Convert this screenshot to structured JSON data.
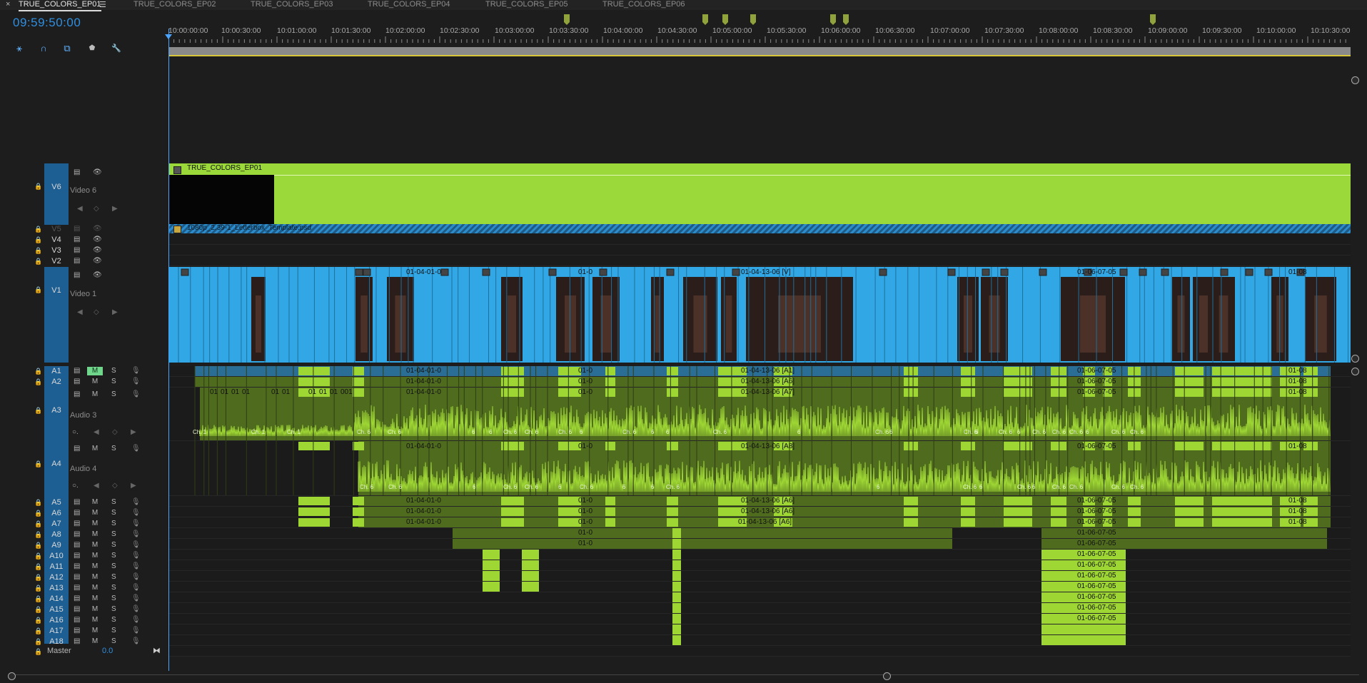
{
  "tabs": [
    {
      "label": "TRUE_COLORS_EP01",
      "active": true
    },
    {
      "label": "TRUE_COLORS_EP02",
      "active": false
    },
    {
      "label": "TRUE_COLORS_EP03",
      "active": false
    },
    {
      "label": "TRUE_COLORS_EP04",
      "active": false
    },
    {
      "label": "TRUE_COLORS_EP05",
      "active": false
    },
    {
      "label": "TRUE_COLORS_EP06",
      "active": false
    }
  ],
  "close_glyph": "×",
  "menu_glyph": "☰",
  "timecode": "09:59:50:00",
  "ruler_labels": [
    "10:00:00:00",
    "10:00:30:00",
    "10:01:00:00",
    "10:01:30:00",
    "10:02:00:00",
    "10:02:30:00",
    "10:03:00:00",
    "10:03:30:00",
    "10:04:00:00",
    "10:04:30:00",
    "10:05:00:00",
    "10:05:30:00",
    "10:06:00:00",
    "10:06:30:00",
    "10:07:00:00",
    "10:07:30:00",
    "10:08:00:00",
    "10:08:30:00",
    "10:09:00:00",
    "10:09:30:00",
    "10:10:00:00",
    "10:10:30:00"
  ],
  "tools": [
    {
      "icon": "snap-icon",
      "glyph": "⚹"
    },
    {
      "icon": "linked-selection-icon",
      "glyph": "∩"
    },
    {
      "icon": "add-marker-icon",
      "glyph": "⧉"
    },
    {
      "icon": "marker-icon",
      "glyph": "⬟"
    },
    {
      "icon": "wrench-icon",
      "glyph": "🔧"
    }
  ],
  "video_tracks": [
    {
      "id": "V6",
      "label": "Video 6"
    },
    {
      "id": "V5"
    },
    {
      "id": "V4"
    },
    {
      "id": "V3"
    },
    {
      "id": "V2"
    },
    {
      "id": "V1",
      "label": "Video 1"
    }
  ],
  "audio_tracks": [
    {
      "id": "A1",
      "m": "M",
      "mute_on": true,
      "s": "S"
    },
    {
      "id": "A2",
      "m": "M",
      "s": "S"
    },
    {
      "id": "A3",
      "label": "Audio 3",
      "m": "M",
      "s": "S"
    },
    {
      "id": "A4",
      "label": "Audio 4",
      "m": "M",
      "s": "S"
    },
    {
      "id": "A5",
      "m": "M",
      "s": "S"
    },
    {
      "id": "A6",
      "m": "M",
      "s": "S"
    },
    {
      "id": "A7",
      "m": "M",
      "s": "S"
    },
    {
      "id": "A8",
      "m": "M",
      "s": "S"
    },
    {
      "id": "A9",
      "m": "M",
      "s": "S"
    },
    {
      "id": "A10",
      "m": "M",
      "s": "S"
    },
    {
      "id": "A11",
      "m": "M",
      "s": "S"
    },
    {
      "id": "A12",
      "m": "M",
      "s": "S"
    },
    {
      "id": "A13",
      "m": "M",
      "s": "S"
    },
    {
      "id": "A14",
      "m": "M",
      "s": "S"
    },
    {
      "id": "A15",
      "m": "M",
      "s": "S"
    },
    {
      "id": "A16",
      "m": "M",
      "s": "S"
    },
    {
      "id": "A17",
      "m": "M",
      "s": "S"
    },
    {
      "id": "A18",
      "m": "M",
      "s": "S"
    }
  ],
  "master": {
    "label": "Master",
    "value": "0.0"
  },
  "clips": {
    "v6_title": "TRUE_COLORS_EP01",
    "v5_letterbox": "1080p_2.39-1_Letterbox_Template.psd",
    "v1_names": [
      "01-04-01-0",
      "01-0",
      "01-04-13-06 [V]",
      "01-06-07-05",
      "01-08"
    ],
    "a1": [
      "01-04-01-0",
      "01-0",
      "01-04-13-06 [A1]",
      "01-06-07-05",
      "01-08"
    ],
    "a2": [
      "01-04-01-0",
      "01-0",
      "01-04-13-06 [A6]",
      "01-06-07-05",
      "01-08"
    ],
    "a3_top": [
      "01-04-01-0",
      "01-0",
      "01-04-13-06 [A7]",
      "01-06-07-05",
      "01-08"
    ],
    "a3_small": [
      "01",
      "01",
      "01",
      "01",
      "01",
      "01",
      "01",
      "01",
      "01",
      "001"
    ],
    "a3_ch": [
      "Ch. 1",
      "Ch. 1",
      "Ch. 1",
      "Ch. 6",
      "Ch. 6",
      "6",
      "6",
      "Ch. 6",
      "Ch. 6",
      "Ch. 6",
      "6",
      "Ch. 6",
      "6",
      "6",
      "Ch. 6",
      "6",
      "Ch. 6",
      "6",
      "Ch. 6",
      "6",
      "Ch. 6",
      "6",
      "Ch. 6",
      "Ch. 6",
      "Ch. 6",
      "6",
      "Ch. 6",
      "Ch. 6"
    ],
    "a4": [
      "01-04-01-0",
      "01-0",
      "01-04-13-06 [A8]",
      "01-06-07-05",
      "01-08"
    ],
    "a4_ch": [
      "Ch. 6",
      "Ch. 6",
      "6",
      "Ch. 6",
      "Ch. 6",
      "6",
      "Ch. 6",
      "6",
      "6",
      "Ch. 6",
      "6",
      "Ch. 6",
      "6",
      "Ch. 6",
      "6",
      "Ch. 6",
      "Ch. 6",
      "Ch. 6",
      "Ch. 6"
    ],
    "a5": [
      "01-04-01-0",
      "01-0",
      "01-04-13-06 [A6]",
      "01-06-07-05",
      "01-08"
    ],
    "a6": [
      "01-04-01-0",
      "01-0",
      "01-04-13-06 [A6]",
      "01-06-07-05",
      "01-08"
    ],
    "a7": [
      "01-04-01-0",
      "01-0",
      "01-04-13-06 [A6]",
      "01-06-07-05",
      "01-08"
    ],
    "a8_16": [
      "01-0",
      "01-06-07-05"
    ]
  },
  "colors": {
    "video": "#32a7e6",
    "audio": "#9ed634",
    "title": "#9bd93a",
    "accent": "#2f8fe0",
    "playhead": "#4aa3ff"
  }
}
